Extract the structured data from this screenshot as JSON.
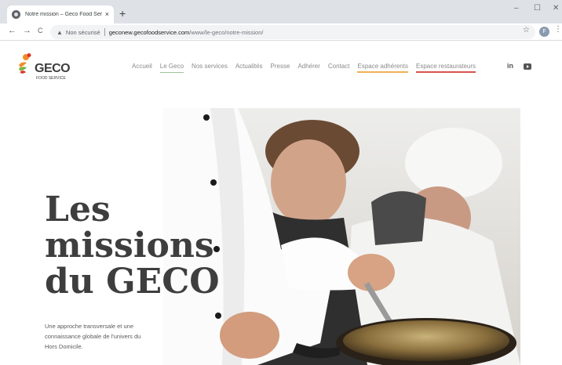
{
  "browser": {
    "tab_title": "Notre mission – Geco Food Serv",
    "tab_close": "×",
    "new_tab": "+",
    "win_min": "–",
    "win_max": "☐",
    "win_close": "✕",
    "back": "←",
    "forward": "→",
    "reload": "C",
    "security_icon": "▲",
    "security_text": "Non sécurisé",
    "url_host": "geconew.gecofoodservice.com",
    "url_path": "/www/le-geco/notre-mission/",
    "bookmark_icon": "☆",
    "profile_initial": "F",
    "menu_icon": "⋮"
  },
  "site": {
    "logo_word": "GECO",
    "logo_sub": "FOOD SERVICE",
    "nav": [
      {
        "label": "Accueil"
      },
      {
        "label": "Le Geco"
      },
      {
        "label": "Nos services"
      },
      {
        "label": "Actualités"
      },
      {
        "label": "Presse"
      },
      {
        "label": "Adhérer"
      },
      {
        "label": "Contact"
      },
      {
        "label": "Espace adhérents"
      },
      {
        "label": "Espace restaurateurs"
      }
    ],
    "social_linkedin": "in",
    "hero_title": [
      "Les",
      "missions",
      "du GECO"
    ],
    "hero_text": "Une approche transversale et une connaissance globale de l'univers du Hors Domicile.",
    "colors": {
      "highlight": "#b7d8b6",
      "adherents_underline": "#f0b055",
      "restaurateurs_underline": "#d9534f",
      "logo_orange": "#f28c28",
      "logo_red": "#d9342b",
      "logo_green": "#7cb342"
    }
  }
}
